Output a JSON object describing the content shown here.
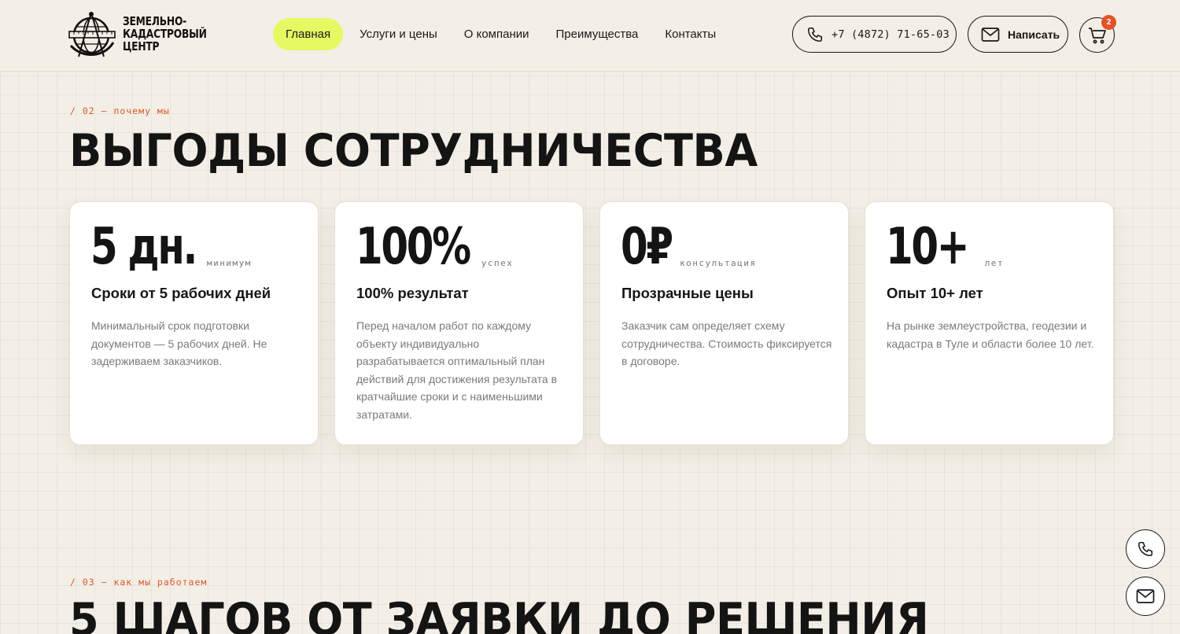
{
  "header": {
    "logo": {
      "lines": [
        "ЗЕМЕЛЬНО-",
        "КАДАСТРОВЫЙ",
        "ЦЕНТР"
      ]
    },
    "nav": [
      {
        "label": "Главная",
        "active": true
      },
      {
        "label": "Услуги и цены",
        "active": false
      },
      {
        "label": "О компании",
        "active": false
      },
      {
        "label": "Преимущества",
        "active": false
      },
      {
        "label": "Контакты",
        "active": false
      }
    ],
    "phone": {
      "label": "+7 (4872) 71-65-03",
      "icon": "phone-icon"
    },
    "write": {
      "label": "Написать",
      "icon": "mail-icon"
    },
    "cart": {
      "count": "2",
      "icon": "cart-icon"
    }
  },
  "benefits": {
    "eyebrow": "/ 02 — почему мы",
    "title": "ВЫГОДЫ СОТРУДНИЧЕСТВА",
    "cards": [
      {
        "stat": "5 дн.",
        "stat_caption": "минимум",
        "title": "Сроки от 5 рабочих дней",
        "text": "Минимальный срок подготовки документов — 5 рабочих дней. Не задерживаем заказчиков."
      },
      {
        "stat": "100%",
        "stat_caption": "успех",
        "title": "100% результат",
        "text": "Перед началом работ по каждому объекту индивидуально разрабатывается оптимальный план действий для достижения результата в кратчайшие сроки и с наименьшими затратами."
      },
      {
        "stat": "0₽",
        "stat_caption": "консультация",
        "title": "Прозрачные цены",
        "text": "Заказчик сам определяет схему сотрудничества. Стоимость фиксируется в договоре."
      },
      {
        "stat": "10+",
        "stat_caption": "лет",
        "title": "Опыт 10+ лет",
        "text": "На рынке землеустройства, геодезии и кадастра в Туле и области более 10 лет."
      }
    ]
  },
  "steps": {
    "eyebrow": "/ 03 — как мы работаем",
    "title": "5 ШАГОВ ОТ ЗАЯВКИ ДО РЕШЕНИЯ"
  },
  "floating": {
    "call_icon": "phone-icon",
    "mail_icon": "mail-icon"
  },
  "colors": {
    "accent": "#e4f962",
    "badge": "#e2532a",
    "eyebrow": "#d8582f",
    "background": "#f3efe6"
  }
}
